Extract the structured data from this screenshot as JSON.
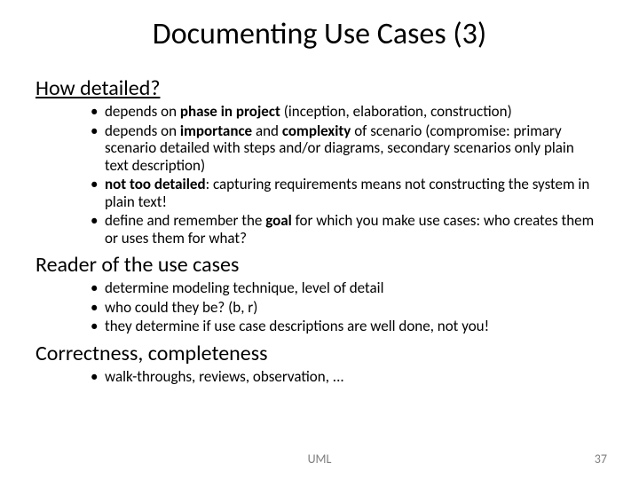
{
  "title": "Documenting Use Cases (3)",
  "sections": [
    {
      "heading": "How detailed?",
      "underline": true,
      "bullets": [
        {
          "pre": "depends on ",
          "b1": "phase in project",
          "mid": " (inception, elaboration, construction)"
        },
        {
          "pre": "depends on ",
          "b1": "importance",
          "mid": " and ",
          "b2": "complexity",
          "post": " of scenario (compromise: primary scenario detailed with steps and/or diagrams, secondary scenarios only plain text description)"
        },
        {
          "b1": "not too detailed",
          "post": ": capturing requirements means not constructing the system in plain text!"
        },
        {
          "pre": "define and remember the ",
          "b1": "goal",
          "post": " for which you make use cases: who creates them or uses them for what?"
        }
      ]
    },
    {
      "heading": "Reader of the use cases",
      "underline": false,
      "bullets": [
        {
          "pre": "determine modeling technique, level of detail"
        },
        {
          "pre": "who could they be? (b, r)"
        },
        {
          "pre": "they determine if use case descriptions are well done, not you!"
        }
      ]
    },
    {
      "heading": "Correctness, completeness",
      "underline": false,
      "bullets": [
        {
          "pre": "walk-throughs, reviews, observation, ..."
        }
      ]
    }
  ],
  "footer": {
    "center": "UML",
    "right": "37"
  }
}
